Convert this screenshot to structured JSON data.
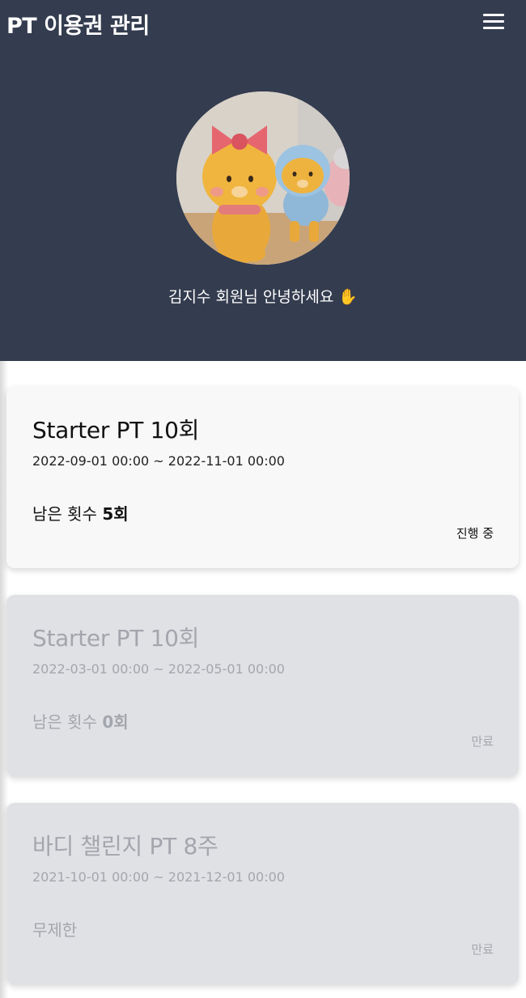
{
  "header": {
    "title": "PT 이용권 관리",
    "menu_icon": "hamburger-menu-icon",
    "greeting": "김지수 회원님 안녕하세요 ✋",
    "background_color": "#343c4f"
  },
  "profile": {
    "avatar_icon": "profile-photo"
  },
  "passes": [
    {
      "title": "Starter PT 10회",
      "period": "2022-09-01 00:00 ~ 2022-11-01 00:00",
      "remaining_prefix": "남은 횟수 ",
      "remaining_value": "5회",
      "status": "진행 중"
    },
    {
      "title": "Starter PT 10회",
      "period": "2022-03-01 00:00 ~ 2022-05-01 00:00",
      "remaining_prefix": "남은 횟수 ",
      "remaining_value": "0회",
      "status": "만료"
    },
    {
      "title": "바디 챌린지 PT 8주",
      "period": "2021-10-01 00:00 ~ 2021-12-01 00:00",
      "remaining_prefix": "무제한",
      "remaining_value": "",
      "status": "만료"
    }
  ],
  "colors": {
    "active_card": "#f8f8f8",
    "expired_card": "#e0e1e5",
    "expired_text": "#a4a6ad"
  }
}
